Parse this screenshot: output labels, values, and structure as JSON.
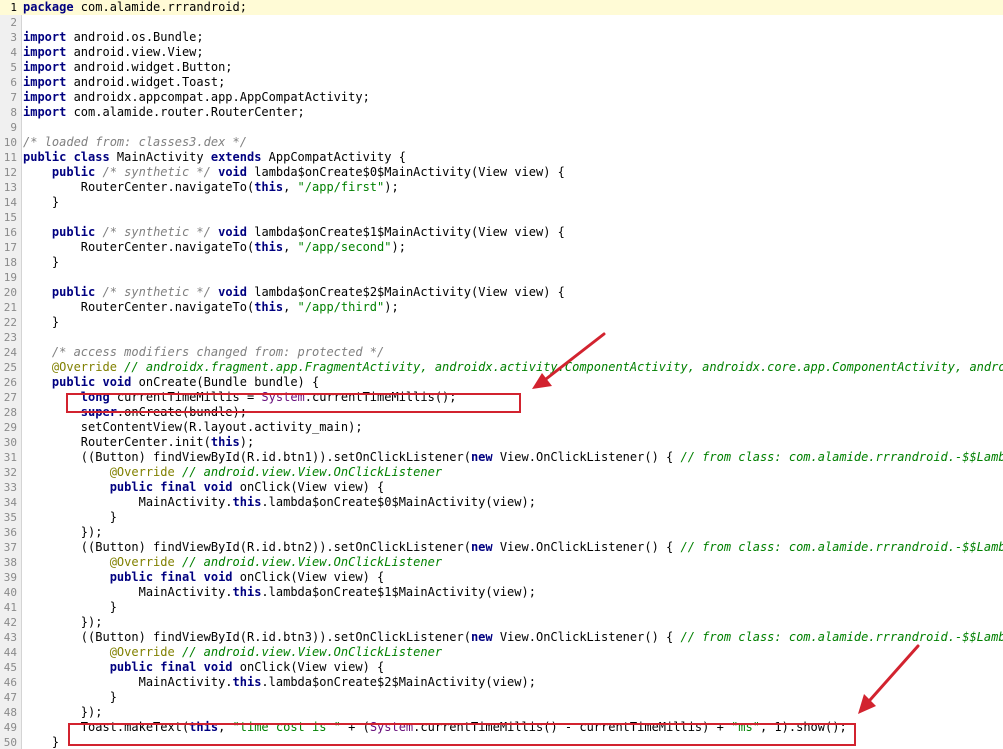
{
  "editor": {
    "current_line": 1,
    "lines": [
      {
        "n": "1",
        "tokens": [
          {
            "t": "package",
            "c": "kw"
          },
          {
            "t": " com.alamide.rrrandroid;"
          }
        ]
      },
      {
        "n": "2",
        "tokens": []
      },
      {
        "n": "3",
        "tokens": [
          {
            "t": "import",
            "c": "kw"
          },
          {
            "t": " android.os.Bundle;"
          }
        ]
      },
      {
        "n": "4",
        "tokens": [
          {
            "t": "import",
            "c": "kw"
          },
          {
            "t": " android.view.View;"
          }
        ]
      },
      {
        "n": "5",
        "tokens": [
          {
            "t": "import",
            "c": "kw"
          },
          {
            "t": " android.widget.Button;"
          }
        ]
      },
      {
        "n": "6",
        "tokens": [
          {
            "t": "import",
            "c": "kw"
          },
          {
            "t": " android.widget.Toast;"
          }
        ]
      },
      {
        "n": "7",
        "tokens": [
          {
            "t": "import",
            "c": "kw"
          },
          {
            "t": " androidx.appcompat.app.AppCompatActivity;"
          }
        ]
      },
      {
        "n": "8",
        "tokens": [
          {
            "t": "import",
            "c": "kw"
          },
          {
            "t": " com.alamide.router.RouterCenter;"
          }
        ]
      },
      {
        "n": "9",
        "tokens": []
      },
      {
        "n": "10",
        "tokens": [
          {
            "t": "/* loaded from: classes3.dex */",
            "c": "cm"
          }
        ]
      },
      {
        "n": "11",
        "tokens": [
          {
            "t": "public class",
            "c": "kw"
          },
          {
            "t": " MainActivity "
          },
          {
            "t": "extends",
            "c": "kw"
          },
          {
            "t": " AppCompatActivity {"
          }
        ]
      },
      {
        "n": "12",
        "tokens": [
          {
            "t": "    "
          },
          {
            "t": "public",
            "c": "kw"
          },
          {
            "t": " "
          },
          {
            "t": "/* synthetic */",
            "c": "cm"
          },
          {
            "t": " "
          },
          {
            "t": "void",
            "c": "kw"
          },
          {
            "t": " lambda$onCreate$0$MainActivity(View view) {"
          }
        ]
      },
      {
        "n": "13",
        "tokens": [
          {
            "t": "        RouterCenter.navigateTo("
          },
          {
            "t": "this",
            "c": "kw"
          },
          {
            "t": ", "
          },
          {
            "t": "\"/app/first\"",
            "c": "st"
          },
          {
            "t": ");"
          }
        ]
      },
      {
        "n": "14",
        "tokens": [
          {
            "t": "    }"
          }
        ]
      },
      {
        "n": "15",
        "tokens": []
      },
      {
        "n": "16",
        "tokens": [
          {
            "t": "    "
          },
          {
            "t": "public",
            "c": "kw"
          },
          {
            "t": " "
          },
          {
            "t": "/* synthetic */",
            "c": "cm"
          },
          {
            "t": " "
          },
          {
            "t": "void",
            "c": "kw"
          },
          {
            "t": " lambda$onCreate$1$MainActivity(View view) {"
          }
        ]
      },
      {
        "n": "17",
        "tokens": [
          {
            "t": "        RouterCenter.navigateTo("
          },
          {
            "t": "this",
            "c": "kw"
          },
          {
            "t": ", "
          },
          {
            "t": "\"/app/second\"",
            "c": "st"
          },
          {
            "t": ");"
          }
        ]
      },
      {
        "n": "18",
        "tokens": [
          {
            "t": "    }"
          }
        ]
      },
      {
        "n": "19",
        "tokens": []
      },
      {
        "n": "20",
        "tokens": [
          {
            "t": "    "
          },
          {
            "t": "public",
            "c": "kw"
          },
          {
            "t": " "
          },
          {
            "t": "/* synthetic */",
            "c": "cm"
          },
          {
            "t": " "
          },
          {
            "t": "void",
            "c": "kw"
          },
          {
            "t": " lambda$onCreate$2$MainActivity(View view) {"
          }
        ]
      },
      {
        "n": "21",
        "tokens": [
          {
            "t": "        RouterCenter.navigateTo("
          },
          {
            "t": "this",
            "c": "kw"
          },
          {
            "t": ", "
          },
          {
            "t": "\"/app/third\"",
            "c": "st"
          },
          {
            "t": ");"
          }
        ]
      },
      {
        "n": "22",
        "tokens": [
          {
            "t": "    }"
          }
        ]
      },
      {
        "n": "23",
        "tokens": []
      },
      {
        "n": "24",
        "tokens": [
          {
            "t": "    "
          },
          {
            "t": "/* access modifiers changed from: protected */",
            "c": "cm"
          }
        ]
      },
      {
        "n": "25",
        "tokens": [
          {
            "t": "    "
          },
          {
            "t": "@Override",
            "c": "an"
          },
          {
            "t": " "
          },
          {
            "t": "// androidx.fragment.app.FragmentActivity, androidx.activity.ComponentActivity, androidx.core.app.ComponentActivity, android.a",
            "c": "cmg"
          }
        ]
      },
      {
        "n": "26",
        "tokens": [
          {
            "t": "    "
          },
          {
            "t": "public void",
            "c": "kw"
          },
          {
            "t": " onCreate(Bundle bundle) {"
          }
        ]
      },
      {
        "n": "27",
        "tokens": [
          {
            "t": "        "
          },
          {
            "t": "long",
            "c": "kw"
          },
          {
            "t": " currentTimeMillis = "
          },
          {
            "t": "System",
            "c": "sy"
          },
          {
            "t": ".currentTimeMillis();"
          }
        ]
      },
      {
        "n": "28",
        "tokens": [
          {
            "t": "        "
          },
          {
            "t": "super",
            "c": "kw"
          },
          {
            "t": ".onCreate(bundle);"
          }
        ]
      },
      {
        "n": "29",
        "tokens": [
          {
            "t": "        setContentView(R.layout.activity_main);"
          }
        ]
      },
      {
        "n": "30",
        "tokens": [
          {
            "t": "        RouterCenter.init("
          },
          {
            "t": "this",
            "c": "kw"
          },
          {
            "t": ");"
          }
        ]
      },
      {
        "n": "31",
        "tokens": [
          {
            "t": "        ((Button) findViewById(R.id.btn1)).setOnClickListener("
          },
          {
            "t": "new",
            "c": "kw"
          },
          {
            "t": " View.OnClickListener() { "
          },
          {
            "t": "// from class: com.alamide.rrrandroid.-$$Lambda$M",
            "c": "cmg"
          }
        ]
      },
      {
        "n": "32",
        "tokens": [
          {
            "t": "            "
          },
          {
            "t": "@Override",
            "c": "an"
          },
          {
            "t": " "
          },
          {
            "t": "// android.view.View.OnClickListener",
            "c": "cmg"
          }
        ]
      },
      {
        "n": "33",
        "tokens": [
          {
            "t": "            "
          },
          {
            "t": "public final void",
            "c": "kw"
          },
          {
            "t": " onClick(View view) {"
          }
        ]
      },
      {
        "n": "34",
        "tokens": [
          {
            "t": "                MainActivity."
          },
          {
            "t": "this",
            "c": "kw"
          },
          {
            "t": ".lambda$onCreate$0$MainActivity(view);"
          }
        ]
      },
      {
        "n": "35",
        "tokens": [
          {
            "t": "            }"
          }
        ]
      },
      {
        "n": "36",
        "tokens": [
          {
            "t": "        });"
          }
        ]
      },
      {
        "n": "37",
        "tokens": [
          {
            "t": "        ((Button) findViewById(R.id.btn2)).setOnClickListener("
          },
          {
            "t": "new",
            "c": "kw"
          },
          {
            "t": " View.OnClickListener() { "
          },
          {
            "t": "// from class: com.alamide.rrrandroid.-$$Lambda$M",
            "c": "cmg"
          }
        ]
      },
      {
        "n": "38",
        "tokens": [
          {
            "t": "            "
          },
          {
            "t": "@Override",
            "c": "an"
          },
          {
            "t": " "
          },
          {
            "t": "// android.view.View.OnClickListener",
            "c": "cmg"
          }
        ]
      },
      {
        "n": "39",
        "tokens": [
          {
            "t": "            "
          },
          {
            "t": "public final void",
            "c": "kw"
          },
          {
            "t": " onClick(View view) {"
          }
        ]
      },
      {
        "n": "40",
        "tokens": [
          {
            "t": "                MainActivity."
          },
          {
            "t": "this",
            "c": "kw"
          },
          {
            "t": ".lambda$onCreate$1$MainActivity(view);"
          }
        ]
      },
      {
        "n": "41",
        "tokens": [
          {
            "t": "            }"
          }
        ]
      },
      {
        "n": "42",
        "tokens": [
          {
            "t": "        });"
          }
        ]
      },
      {
        "n": "43",
        "tokens": [
          {
            "t": "        ((Button) findViewById(R.id.btn3)).setOnClickListener("
          },
          {
            "t": "new",
            "c": "kw"
          },
          {
            "t": " View.OnClickListener() { "
          },
          {
            "t": "// from class: com.alamide.rrrandroid.-$$Lambda$M",
            "c": "cmg"
          }
        ]
      },
      {
        "n": "44",
        "tokens": [
          {
            "t": "            "
          },
          {
            "t": "@Override",
            "c": "an"
          },
          {
            "t": " "
          },
          {
            "t": "// android.view.View.OnClickListener",
            "c": "cmg"
          }
        ]
      },
      {
        "n": "45",
        "tokens": [
          {
            "t": "            "
          },
          {
            "t": "public final void",
            "c": "kw"
          },
          {
            "t": " onClick(View view) {"
          }
        ]
      },
      {
        "n": "46",
        "tokens": [
          {
            "t": "                MainActivity."
          },
          {
            "t": "this",
            "c": "kw"
          },
          {
            "t": ".lambda$onCreate$2$MainActivity(view);"
          }
        ]
      },
      {
        "n": "47",
        "tokens": [
          {
            "t": "            }"
          }
        ]
      },
      {
        "n": "48",
        "tokens": [
          {
            "t": "        });"
          }
        ]
      },
      {
        "n": "49",
        "tokens": [
          {
            "t": "        Toast.makeText("
          },
          {
            "t": "this",
            "c": "kw"
          },
          {
            "t": ", "
          },
          {
            "t": "\"time cost is \"",
            "c": "st"
          },
          {
            "t": " + ("
          },
          {
            "t": "System",
            "c": "sy"
          },
          {
            "t": ".currentTimeMillis() - currentTimeMillis) + "
          },
          {
            "t": "\"ms\"",
            "c": "st"
          },
          {
            "t": ", 1).show();"
          }
        ]
      },
      {
        "n": "50",
        "tokens": [
          {
            "t": "    }"
          }
        ]
      }
    ]
  },
  "colors": {
    "keyword": "#000080",
    "comment": "#808080",
    "string": "#008000",
    "annotation": "#808000",
    "highlight": "#d2232f",
    "current_line": "#fffbd6"
  }
}
